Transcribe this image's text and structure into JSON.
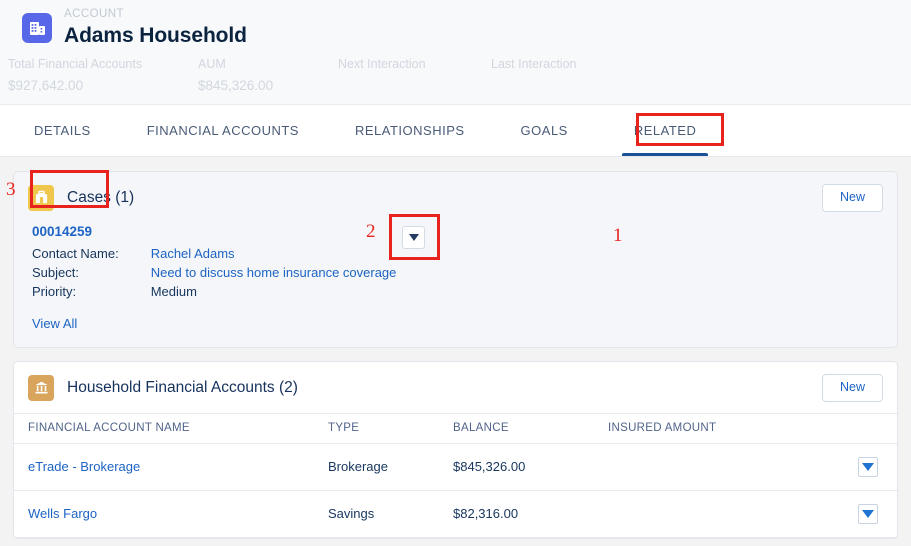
{
  "record_header": {
    "object_icon": "account-building-icon",
    "eyebrow": "ACCOUNT",
    "name": "Adams Household",
    "accent_color": "#5867e8",
    "fields": [
      {
        "label": "Total Financial Accounts",
        "value": "$927,642.00"
      },
      {
        "label": "AUM",
        "value": "$845,326.00"
      },
      {
        "label": "Next Interaction",
        "value": ""
      },
      {
        "label": "Last Interaction",
        "value": ""
      }
    ]
  },
  "tabs": {
    "items": [
      {
        "label": "DETAILS",
        "active": false
      },
      {
        "label": "FINANCIAL ACCOUNTS",
        "active": false
      },
      {
        "label": "RELATIONSHIPS",
        "active": false
      },
      {
        "label": "GOALS",
        "active": false
      },
      {
        "label": "RELATED",
        "active": true
      }
    ],
    "active_underline_color": "#1b5297"
  },
  "annotations": {
    "color": "#e8231e",
    "markers": [
      {
        "number": "1",
        "target": "related-tab"
      },
      {
        "number": "2",
        "target": "case-row-dropdown"
      },
      {
        "number": "3",
        "target": "cases-new-button"
      }
    ]
  },
  "cases_card": {
    "icon": "briefcase-icon",
    "icon_color": "#eec74c",
    "title": "Cases (1)",
    "new_label": "New",
    "record": {
      "case_number": "00014259",
      "fields": [
        {
          "label": "Contact Name:",
          "value": "Rachel Adams",
          "is_link": true
        },
        {
          "label": "Subject:",
          "value": "Need to discuss home insurance coverage",
          "is_link": true
        },
        {
          "label": "Priority:",
          "value": "Medium",
          "is_link": false
        }
      ],
      "row_menu_icon": "chevron-down-icon"
    },
    "view_all_label": "View All"
  },
  "financial_accounts_card": {
    "icon": "bank-icon",
    "icon_color": "#d9a45b",
    "title": "Household Financial Accounts (2)",
    "new_label": "New",
    "columns": [
      "FINANCIAL ACCOUNT NAME",
      "TYPE",
      "BALANCE",
      "INSURED AMOUNT"
    ],
    "rows": [
      {
        "name": "eTrade - Brokerage",
        "type": "Brokerage",
        "balance": "$845,326.00",
        "insured_amount": "",
        "row_menu_icon": "caret-down-icon"
      },
      {
        "name": "Wells Fargo",
        "type": "Savings",
        "balance": "$82,316.00",
        "insured_amount": "",
        "row_menu_icon": "caret-down-icon"
      }
    ]
  }
}
